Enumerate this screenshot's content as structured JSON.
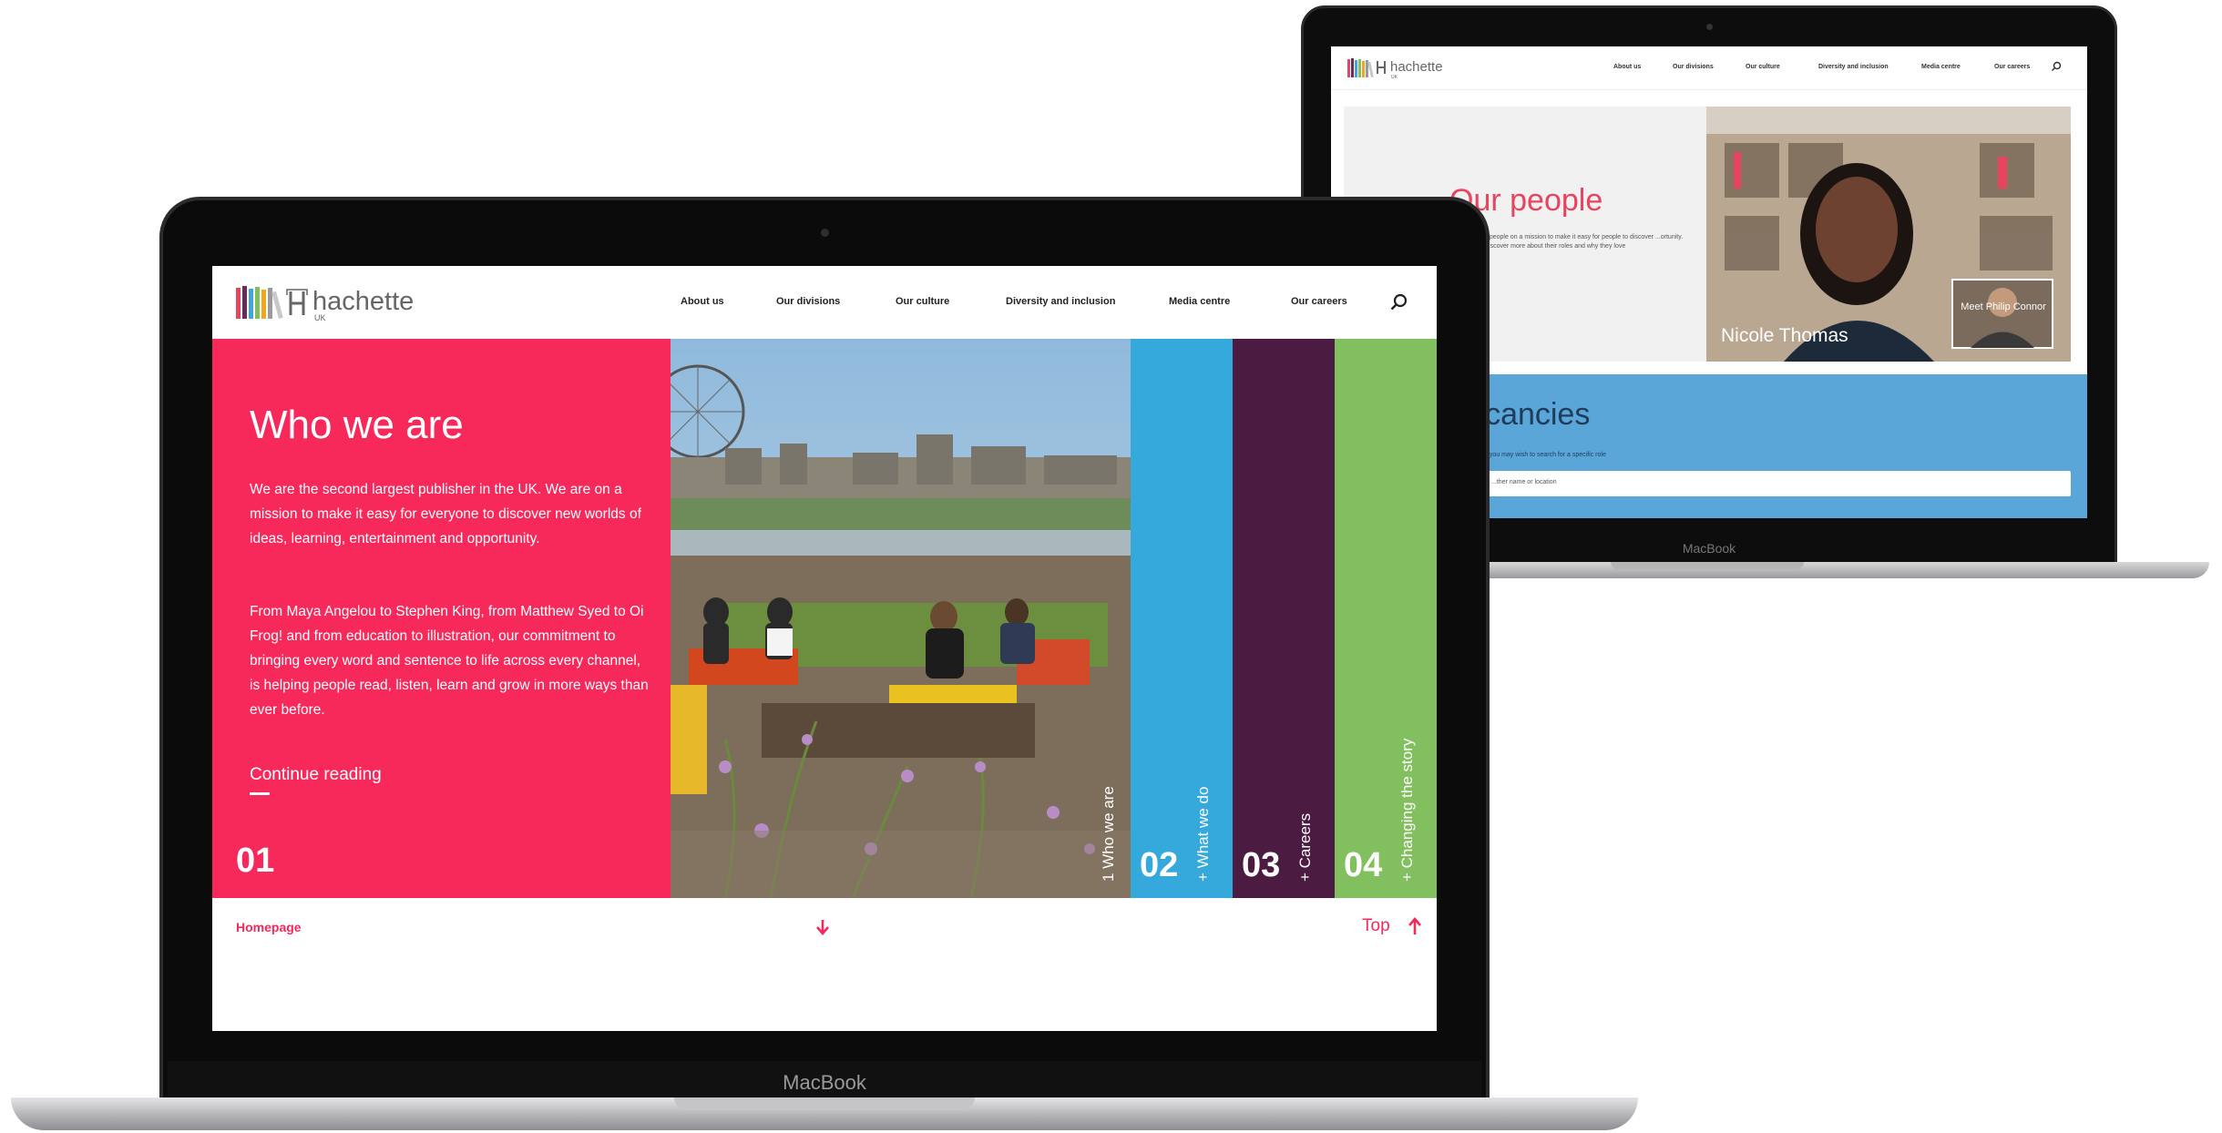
{
  "front": {
    "logo_text": "hachette",
    "logo_sub": "UK",
    "nav": [
      "About us",
      "Our divisions",
      "Our culture",
      "Diversity and inclusion",
      "Media centre",
      "Our careers"
    ],
    "hero": {
      "title": "Who we are",
      "para1": "We are the second largest publisher in the UK.  We are on a mission to make it easy for everyone to discover new worlds of ideas, learning, entertainment and opportunity.",
      "para2": "From Maya Angelou to Stephen King, from Matthew Syed to Oi Frog! and from education to illustration, our commitment to bringing every word and sentence to life across every channel, is helping people read, listen, learn and grow in more ways than ever before.",
      "cta": "Continue reading",
      "number": "01"
    },
    "strips": [
      {
        "label": "1  Who we are",
        "number": "",
        "color": "#f7285a"
      },
      {
        "label": "+ What we do",
        "number": "02",
        "color": "#35a9dc"
      },
      {
        "label": "+ Careers",
        "number": "03",
        "color": "#4b1b42"
      },
      {
        "label": "+ Changing the story",
        "number": "04",
        "color": "#82bf5e"
      }
    ],
    "footer": {
      "home": "Homepage",
      "arrow": "↓",
      "top": "Top",
      "top_arrow": "↑"
    },
    "brand": "MacBook"
  },
  "back": {
    "logo_text": "hachette",
    "logo_sub": "UK",
    "nav": [
      "About us",
      "Our divisions",
      "Our culture",
      "Diversity and inclusion",
      "Media centre",
      "Our careers"
    ],
    "hero_title": "Our people",
    "hero_body": "...people on a mission to make it easy for people to discover ...ortunity. Discover more about their roles and why they love",
    "photo_caption": "Nicole Thomas",
    "inset_caption": "Meet Philip Connor",
    "vacancies_title": "Vacancies",
    "vacancies_sub": "...you may wish to search for a specific role",
    "search_placeholder": "...ther name or location",
    "brand": "MacBook"
  },
  "colors": {
    "pink": "#f7285a",
    "blue": "#35a9dc",
    "plum": "#4b1b42",
    "green": "#82bf5e",
    "back_blue": "#5aa6d8",
    "back_title_red": "#e8435f"
  }
}
